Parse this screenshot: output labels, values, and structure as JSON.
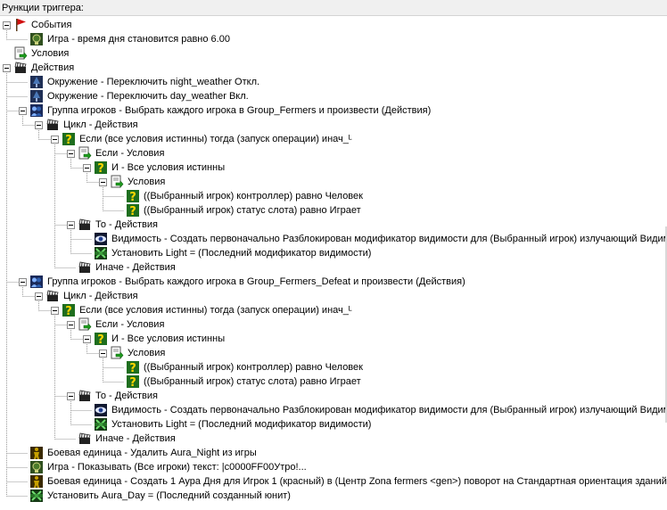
{
  "panel": {
    "title": "Рункции триггера:"
  },
  "rows": [
    {
      "text": "События",
      "depth": 0,
      "icon": "event-flag-icon",
      "toggle": true,
      "name": "tree-node-events"
    },
    {
      "text": "Игра - время дня становится равно 6.00",
      "depth": 1,
      "icon": "game-event-icon",
      "toggle": false,
      "name": "tree-node-event-time-of-day"
    },
    {
      "text": "Условия",
      "depth": 0,
      "icon": "conditions-icon",
      "toggle": false,
      "name": "tree-node-conditions"
    },
    {
      "text": "Действия",
      "depth": 0,
      "icon": "actions-clapper-icon",
      "toggle": true,
      "name": "tree-node-actions"
    },
    {
      "text": "Окружение - Переключить night_weather Откл.",
      "depth": 1,
      "icon": "environment-icon",
      "toggle": false,
      "name": "tree-node-action-night-weather"
    },
    {
      "text": "Окружение - Переключить day_weather Вкл.",
      "depth": 1,
      "icon": "environment-icon",
      "toggle": false,
      "name": "tree-node-action-day-weather"
    },
    {
      "text": "Группа игроков - Выбрать каждого игрока в Group_Fermers и произвести (Действия)",
      "depth": 1,
      "icon": "player-group-icon",
      "toggle": true,
      "name": "tree-node-player-group-fermers"
    },
    {
      "text": "Цикл - Действия",
      "depth": 2,
      "icon": "actions-clapper-icon",
      "toggle": true,
      "name": "tree-node-loop-actions"
    },
    {
      "text": "Если (все условия истинны) тогда (запуск операции) инач_ᴸ",
      "depth": 3,
      "icon": "if-question-icon",
      "toggle": true,
      "name": "tree-node-if-then-else"
    },
    {
      "text": "Если - Условия",
      "depth": 4,
      "icon": "conditions-icon",
      "toggle": true,
      "name": "tree-node-if-conditions"
    },
    {
      "text": "И - Все условия истинны",
      "depth": 5,
      "icon": "if-question-icon",
      "toggle": true,
      "name": "tree-node-and-all-true"
    },
    {
      "text": "Условия",
      "depth": 6,
      "icon": "conditions-icon",
      "toggle": true,
      "name": "tree-node-sub-conditions"
    },
    {
      "text": "((Выбранный игрок) контроллер) равно Человек",
      "depth": 7,
      "icon": "if-question-icon",
      "toggle": false,
      "name": "tree-node-condition-controller"
    },
    {
      "text": "((Выбранный игрок) статус слота) равно Играет",
      "depth": 7,
      "icon": "if-question-icon",
      "toggle": false,
      "name": "tree-node-condition-slot-status"
    },
    {
      "text": "То - Действия",
      "depth": 4,
      "icon": "actions-clapper-icon",
      "toggle": true,
      "name": "tree-node-then-actions"
    },
    {
      "text": "Видимость - Создать первоначально Разблокирован модификатор видимости для (Выбранный игрок) излучающий Видим",
      "depth": 5,
      "icon": "visibility-eye-icon",
      "toggle": false,
      "name": "tree-node-action-visibility"
    },
    {
      "text": "Установить Light = (Последний модификатор видимости)",
      "depth": 5,
      "icon": "set-variable-icon",
      "toggle": false,
      "name": "tree-node-action-set-light"
    },
    {
      "text": "Иначе - Действия",
      "depth": 4,
      "icon": "actions-clapper-icon",
      "toggle": false,
      "name": "tree-node-else-actions"
    },
    {
      "text": "Группа игроков - Выбрать каждого игрока в Group_Fermers_Defeat и произвести (Действия)",
      "depth": 1,
      "icon": "player-group-icon",
      "toggle": true,
      "name": "tree-node-player-group-fermers-defeat"
    },
    {
      "text": "Цикл - Действия",
      "depth": 2,
      "icon": "actions-clapper-icon",
      "toggle": true,
      "name": "tree-node-loop-actions"
    },
    {
      "text": "Если (все условия истинны) тогда (запуск операции) инач_ᴸ",
      "depth": 3,
      "icon": "if-question-icon",
      "toggle": true,
      "name": "tree-node-if-then-else"
    },
    {
      "text": "Если - Условия",
      "depth": 4,
      "icon": "conditions-icon",
      "toggle": true,
      "name": "tree-node-if-conditions"
    },
    {
      "text": "И - Все условия истинны",
      "depth": 5,
      "icon": "if-question-icon",
      "toggle": true,
      "name": "tree-node-and-all-true"
    },
    {
      "text": "Условия",
      "depth": 6,
      "icon": "conditions-icon",
      "toggle": true,
      "name": "tree-node-sub-conditions"
    },
    {
      "text": "((Выбранный игрок) контроллер) равно Человек",
      "depth": 7,
      "icon": "if-question-icon",
      "toggle": false,
      "name": "tree-node-condition-controller"
    },
    {
      "text": "((Выбранный игрок) статус слота) равно Играет",
      "depth": 7,
      "icon": "if-question-icon",
      "toggle": false,
      "name": "tree-node-condition-slot-status"
    },
    {
      "text": "То - Действия",
      "depth": 4,
      "icon": "actions-clapper-icon",
      "toggle": true,
      "name": "tree-node-then-actions"
    },
    {
      "text": "Видимость - Создать первоначально Разблокирован модификатор видимости для (Выбранный игрок) излучающий Видим",
      "depth": 5,
      "icon": "visibility-eye-icon",
      "toggle": false,
      "name": "tree-node-action-visibility"
    },
    {
      "text": "Установить Light = (Последний модификатор видимости)",
      "depth": 5,
      "icon": "set-variable-icon",
      "toggle": false,
      "name": "tree-node-action-set-light"
    },
    {
      "text": "Иначе - Действия",
      "depth": 4,
      "icon": "actions-clapper-icon",
      "toggle": false,
      "name": "tree-node-else-actions"
    },
    {
      "text": "Боевая единица - Удалить Aura_Night из игры",
      "depth": 1,
      "icon": "unit-icon",
      "toggle": false,
      "name": "tree-node-action-remove-aura-night"
    },
    {
      "text": "Игра - Показывать (Все игроки) текст: |c0000FF00Утро!...",
      "depth": 1,
      "icon": "game-event-icon",
      "toggle": false,
      "name": "tree-node-action-show-text"
    },
    {
      "text": "Боевая единица - Создать 1 Аура Дня для Игрок 1 (красный) в (Центр Zona fermers <gen>) поворот на Стандартная ориентация зданий гр",
      "depth": 1,
      "icon": "unit-icon",
      "toggle": false,
      "name": "tree-node-action-create-aura-day"
    },
    {
      "text": "Установить Aura_Day = (Последний созданный юнит)",
      "depth": 1,
      "icon": "set-variable-icon",
      "toggle": false,
      "name": "tree-node-action-set-aura-day"
    }
  ],
  "colors": {
    "flag_red": "#d01010",
    "event_green": "#4a7a2a",
    "question_bg": "#1e6e1e",
    "question_fg": "#ffd700",
    "env_blue": "#4a78b8",
    "group_blue": "#2e5fb0",
    "eye_blue": "#1c3a8c",
    "set_green": "#2d8a2d",
    "unit_yellow": "#c8a000"
  }
}
